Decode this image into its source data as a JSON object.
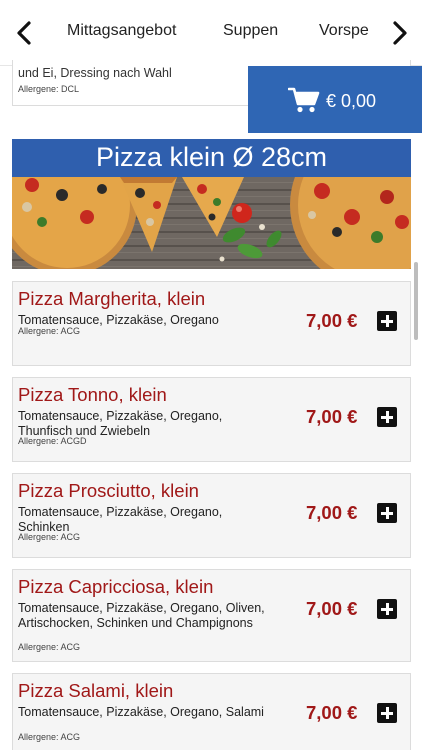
{
  "nav": {
    "tabs": [
      "Mittagsangebot",
      "Suppen",
      "Vorspe"
    ]
  },
  "prev_item": {
    "description": "und Ei, Dressing nach Wahl",
    "allergens": "Allergene: DCL"
  },
  "cart": {
    "total": "€ 0,00",
    "icon": "shopping-cart-icon"
  },
  "category": {
    "title": "Pizza klein Ø 28cm",
    "image": "pizza-banner-photo"
  },
  "items": [
    {
      "name": "Pizza Margherita, klein",
      "description": "Tomatensauce, Pizzakäse, Oregano",
      "allergens": "Allergene: ACG",
      "price": "7,00 €"
    },
    {
      "name": "Pizza Tonno, klein",
      "description": "Tomatensauce, Pizzakäse, Oregano, Thunfisch und Zwiebeln",
      "allergens": "Allergene: ACGD",
      "price": "7,00 €"
    },
    {
      "name": "Pizza Prosciutto, klein",
      "description": "Tomatensauce, Pizzakäse, Oregano, Schinken",
      "allergens": "Allergene: ACG",
      "price": "7,00 €"
    },
    {
      "name": "Pizza Capricciosa, klein",
      "description": "Tomatensauce, Pizzakäse, Oregano, Oliven, Artischocken, Schinken und Champignons",
      "allergens": "Allergene: ACG",
      "price": "7,00 €"
    },
    {
      "name": "Pizza Salami, klein",
      "description": "Tomatensauce, Pizzakäse, Oregano, Salami",
      "allergens": "Allergene: ACG",
      "price": "7,00 €"
    }
  ],
  "colors": {
    "accent_blue": "#2f66b4",
    "banner_blue": "#2f5fae",
    "item_red": "#a01818"
  }
}
